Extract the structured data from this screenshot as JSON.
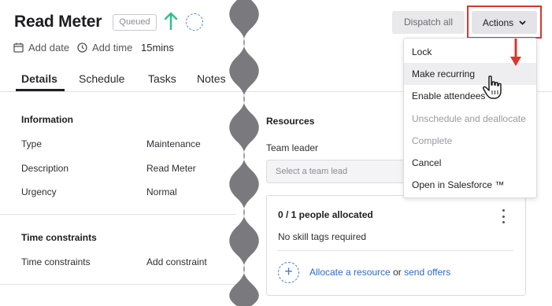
{
  "header": {
    "title": "Read Meter",
    "status_badge": "Queued",
    "add_date": "Add date",
    "add_time": "Add time",
    "duration": "15mins"
  },
  "tabs": [
    {
      "label": "Details"
    },
    {
      "label": "Schedule"
    },
    {
      "label": "Tasks"
    },
    {
      "label": "Notes"
    }
  ],
  "information": {
    "heading": "Information",
    "rows": [
      {
        "label": "Type",
        "value": "Maintenance"
      },
      {
        "label": "Description",
        "value": "Read Meter"
      },
      {
        "label": "Urgency",
        "value": "Normal"
      }
    ]
  },
  "time_constraints": {
    "heading": "Time constraints",
    "row_label": "Time constraints",
    "row_value": "Add constraint"
  },
  "resources": {
    "heading": "Resources",
    "team_leader_label": "Team leader",
    "team_leader_placeholder": "Select a team lead",
    "allocated": "0 / 1 people allocated",
    "skill_tags": "No skill tags required",
    "allocate_link": "Allocate a resource",
    "or_text": "or",
    "send_offers_link": "send offers"
  },
  "toolbar": {
    "dispatch_all": "Dispatch all",
    "actions": "Actions"
  },
  "actions_menu": [
    {
      "label": "Lock",
      "disabled": false
    },
    {
      "label": "Make recurring",
      "disabled": false
    },
    {
      "label": "Enable attendees",
      "disabled": false
    },
    {
      "label": "Unschedule and deallocate",
      "disabled": true
    },
    {
      "label": "Complete",
      "disabled": true
    },
    {
      "label": "Cancel",
      "disabled": false
    },
    {
      "label": "Open in Salesforce ™",
      "disabled": false
    }
  ],
  "colors": {
    "accent_blue": "#3b7bd4",
    "success_green": "#2fc08a",
    "highlight_red": "#d8372e"
  }
}
